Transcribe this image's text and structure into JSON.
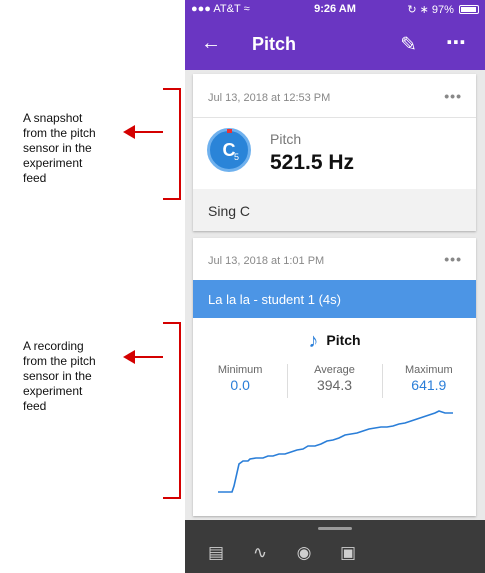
{
  "annotations": {
    "snapshot": "A snapshot\nfrom the pitch\nsensor in the\nexperiment\nfeed",
    "recording": "A recording\nfrom the pitch\nsensor in the\nexperiment\nfeed"
  },
  "status_bar": {
    "carrier": "AT&T",
    "time": "9:26 AM",
    "battery": "97%"
  },
  "app_bar": {
    "title": "Pitch",
    "back_icon": "arrow-left-icon",
    "edit_icon": "pencil-icon",
    "more_icon": "more-horizontal-icon"
  },
  "snapshot_card": {
    "date": "Jul 13, 2018 at 12:53 PM",
    "note_letter": "C",
    "note_octave": "5",
    "sensor_label": "Pitch",
    "value": "521.5 Hz",
    "note_text": "Sing C"
  },
  "recording_card": {
    "date": "Jul 13, 2018 at 1:01 PM",
    "title": "La la la - student 1 (4s)",
    "sensor_label": "Pitch",
    "stats": [
      {
        "label": "Minimum",
        "value": "0.0"
      },
      {
        "label": "Average",
        "value": "394.3"
      },
      {
        "label": "Maximum",
        "value": "641.9"
      }
    ]
  },
  "bottom_tools": [
    "note-icon",
    "sensor-wave-icon",
    "camera-icon",
    "gallery-icon"
  ],
  "colors": {
    "app_bar": "#6a36c2",
    "accent_blue": "#2a7ed8",
    "title_bar": "#4c95e5",
    "annotation_red": "#d40000",
    "bottom_bar": "#3b3b3b"
  }
}
